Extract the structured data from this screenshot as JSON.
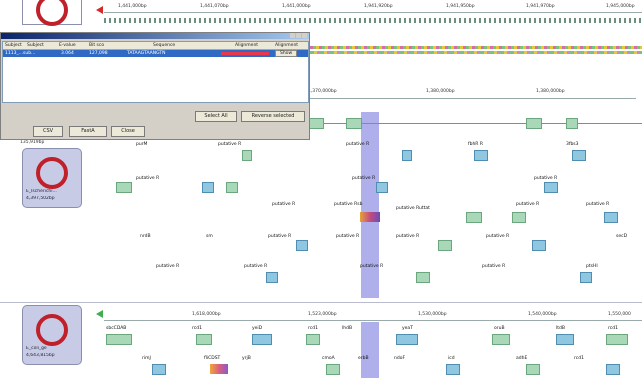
{
  "colors": {
    "accent": "#c0202a",
    "highlight": "#6e6edc",
    "gene_fill": "#a9d8b8",
    "gene_fill_alt": "#8fc7e0"
  },
  "top_ruler": {
    "ticks": [
      "1,441,000bp",
      "1,441,070bp",
      "1,441,000bp",
      "1,941,920bp",
      "1,941,950bp",
      "1,941,970bp",
      "1,945,000bp"
    ]
  },
  "dialog": {
    "columns": [
      "Subject",
      "Subject",
      "E-value",
      "Bit sco",
      "Sequence",
      "Alignment",
      "Alignment"
    ],
    "selected_row": {
      "subject": "1113_...sub...",
      "evalue": "3.064",
      "bitscore": "127,098",
      "sequence": "TATAAGTAANGTN",
      "show": "Show"
    },
    "buttons": {
      "select_all": "Select All",
      "reverse_selected": "Reverse selected",
      "csv": "CSV",
      "fasta": "FastA",
      "close": "Close"
    }
  },
  "panel1": {
    "ruler": [
      "1,370,000bp",
      "1,380,000bp",
      "1,380,000bp"
    ],
    "left_coord": "135,919bp",
    "genes_row1": [
      "purM",
      "putative R",
      "putative R",
      "fbhR R",
      "3fbs3"
    ],
    "genes_row2": [
      "putative R",
      "putative R",
      "putative R"
    ],
    "genes_row3": [
      "putative R",
      "putative Rsb",
      "putative Ruttat",
      "putative R",
      "putative R"
    ],
    "genes_row4": [
      "nrdB",
      "sm",
      "putative R",
      "putative R",
      "putative R",
      "putative R",
      "secD"
    ],
    "genes_row5": [
      "putative R",
      "putative R",
      "putative R",
      "putative R",
      "ptsHI"
    ],
    "genome": {
      "name": "E_Ischerichi...",
      "size": "4,397,502bp"
    }
  },
  "panel2": {
    "ruler": [
      "1,618,000bp",
      "1,523,000bp",
      "1,530,000bp",
      "1,540,000bp",
      "1,550,000"
    ],
    "genes_row1": [
      "sbcCDAB",
      "rcd1",
      "yeiD",
      "rcd1",
      "lhdB",
      "yeaT",
      "oruB",
      "ltdB",
      "rcd1"
    ],
    "genes_row2": [
      "rimJ",
      "fliCDST",
      "yrjB",
      "cmoA",
      "erbB",
      "ndoF",
      "icd",
      "adhE",
      "rcd1"
    ],
    "genome": {
      "name": "E_coli_ge",
      "size": "4,643,815bp"
    }
  }
}
